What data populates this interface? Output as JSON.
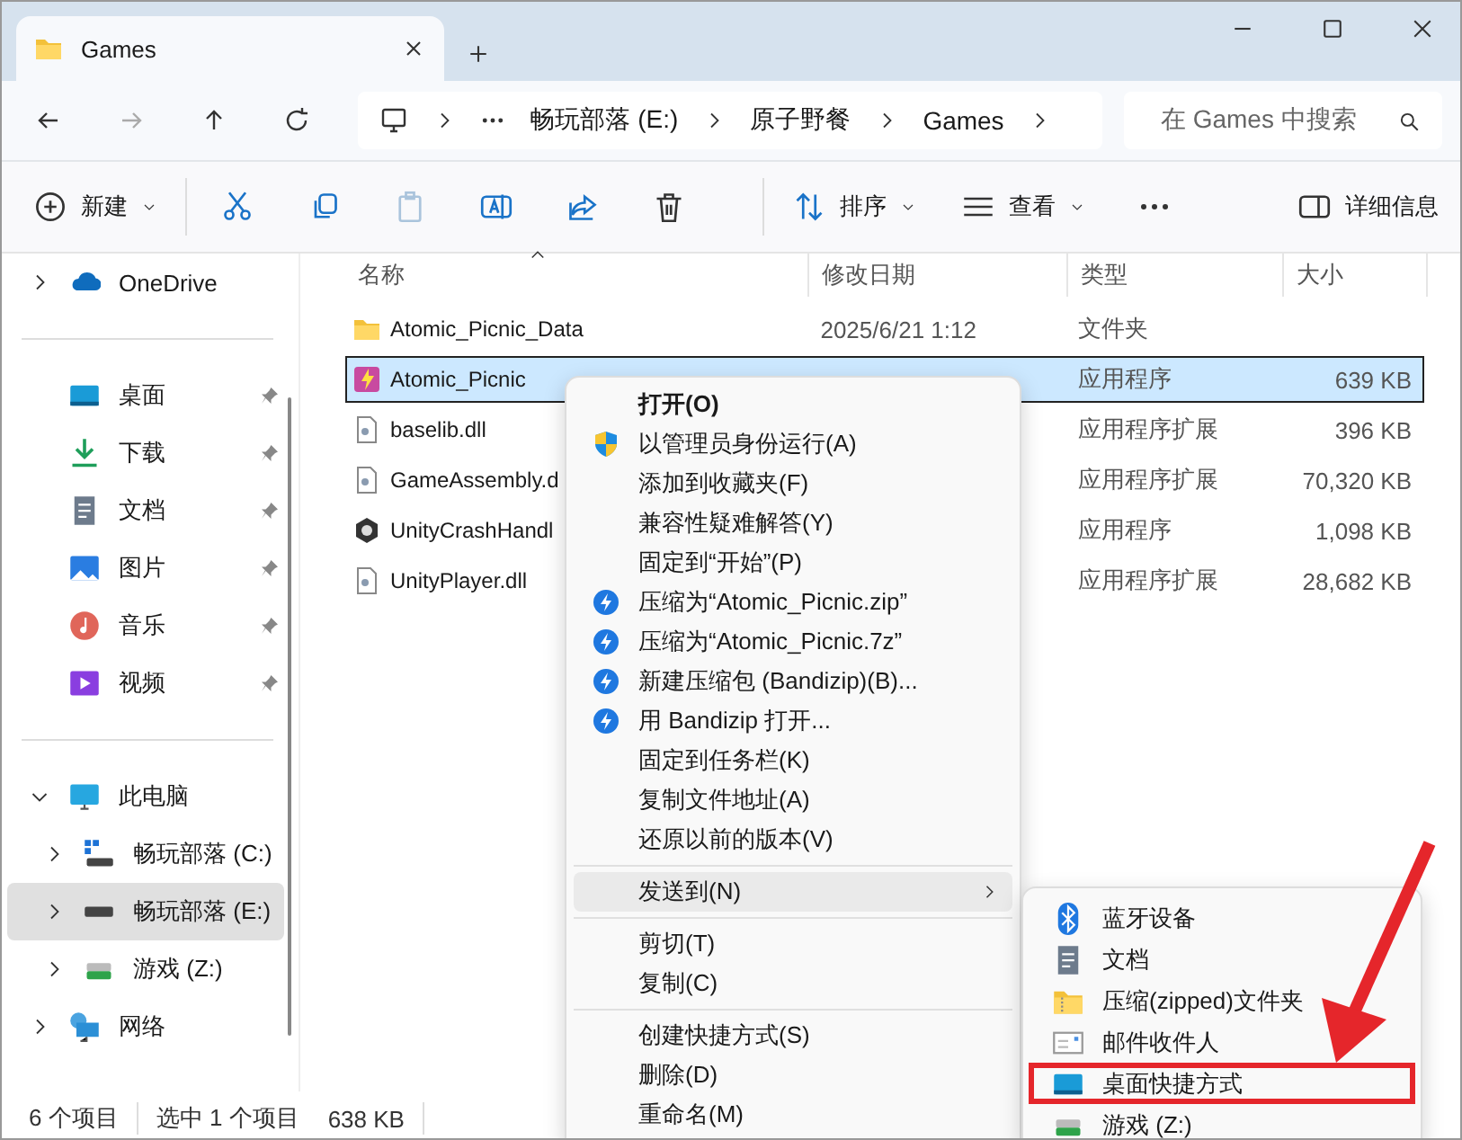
{
  "window": {
    "tab_title": "Games"
  },
  "address": {
    "crumbs": [
      "畅玩部落 (E:)",
      "原子野餐",
      "Games"
    ],
    "search_placeholder": "在 Games 中搜索"
  },
  "toolbar": {
    "new": "新建",
    "sort": "排序",
    "view": "查看",
    "details": "详细信息"
  },
  "sidebar": {
    "sections": [
      [
        {
          "label": "OneDrive",
          "kind": "cloud",
          "expanded": false,
          "selected": false
        }
      ],
      [
        {
          "label": "桌面",
          "kind": "desktop",
          "pinned": true,
          "selected": false
        },
        {
          "label": "下载",
          "kind": "download",
          "pinned": true,
          "selected": false
        },
        {
          "label": "文档",
          "kind": "document",
          "pinned": true,
          "selected": false
        },
        {
          "label": "图片",
          "kind": "picture",
          "pinned": true,
          "selected": false
        },
        {
          "label": "音乐",
          "kind": "music",
          "pinned": true,
          "selected": false
        },
        {
          "label": "视频",
          "kind": "video",
          "pinned": true,
          "selected": false
        }
      ],
      [
        {
          "label": "此电脑",
          "kind": "computer",
          "expanded": true,
          "selected": false,
          "children": [
            {
              "label": "畅玩部落 (C:)",
              "kind": "system-drive",
              "expanded": false,
              "selected": false
            },
            {
              "label": "畅玩部落 (E:)",
              "kind": "drive",
              "expanded": false,
              "selected": true
            },
            {
              "label": "游戏 (Z:)",
              "kind": "green-drive",
              "expanded": false,
              "selected": false
            }
          ]
        },
        {
          "label": "网络",
          "kind": "network",
          "expanded": false,
          "selected": false
        }
      ]
    ]
  },
  "table": {
    "columns": [
      "名称",
      "修改日期",
      "类型",
      "大小"
    ],
    "rows": [
      {
        "name": "Atomic_Picnic_Data",
        "kind": "folder",
        "date": "2025/6/21 1:12",
        "type": "文件夹",
        "selected": false
      },
      {
        "name": "Atomic_Picnic",
        "kind": "game",
        "type": "应用程序",
        "size": "639 KB",
        "selected": true
      },
      {
        "name": "baselib.dll",
        "kind": "dll",
        "type": "应用程序扩展",
        "size": "396 KB",
        "selected": false
      },
      {
        "name": "GameAssembly.d",
        "kind": "dll",
        "type": "应用程序扩展",
        "size": "70,320 KB",
        "selected": false
      },
      {
        "name": "UnityCrashHandl",
        "kind": "unity",
        "type": "应用程序",
        "size": "1,098 KB",
        "selected": false
      },
      {
        "name": "UnityPlayer.dll",
        "kind": "dll",
        "type": "应用程序扩展",
        "size": "28,682 KB",
        "selected": false
      }
    ]
  },
  "context_menu": {
    "groups": [
      [
        {
          "label": "打开(O)",
          "kind": "default",
          "highlighted": false
        },
        {
          "label": "以管理员身份运行(A)",
          "kind": "shield",
          "highlighted": false
        },
        {
          "label": "添加到收藏夹(F)",
          "kind": "plain",
          "highlighted": false
        },
        {
          "label": "兼容性疑难解答(Y)",
          "kind": "plain",
          "highlighted": false
        },
        {
          "label": "固定到“开始”(P)",
          "kind": "plain",
          "highlighted": false
        },
        {
          "label": "压缩为“Atomic_Picnic.zip”",
          "kind": "bandizip",
          "highlighted": false
        },
        {
          "label": "压缩为“Atomic_Picnic.7z”",
          "kind": "bandizip",
          "highlighted": false
        },
        {
          "label": "新建压缩包 (Bandizip)(B)...",
          "kind": "bandizip",
          "highlighted": false
        },
        {
          "label": "用 Bandizip 打开...",
          "kind": "bandizip",
          "highlighted": false
        },
        {
          "label": "固定到任务栏(K)",
          "kind": "plain",
          "highlighted": false
        },
        {
          "label": "复制文件地址(A)",
          "kind": "plain",
          "highlighted": false
        },
        {
          "label": "还原以前的版本(V)",
          "kind": "plain",
          "highlighted": false
        }
      ],
      [
        {
          "label": "发送到(N)",
          "kind": "submenu",
          "highlighted": true
        }
      ],
      [
        {
          "label": "剪切(T)",
          "kind": "plain",
          "highlighted": false
        },
        {
          "label": "复制(C)",
          "kind": "plain",
          "highlighted": false
        }
      ],
      [
        {
          "label": "创建快捷方式(S)",
          "kind": "plain",
          "highlighted": false
        },
        {
          "label": "删除(D)",
          "kind": "plain",
          "highlighted": false
        },
        {
          "label": "重命名(M)",
          "kind": "plain",
          "highlighted": false
        }
      ]
    ]
  },
  "send_to_menu": {
    "items": [
      {
        "label": "蓝牙设备",
        "kind": "bluetooth",
        "marked": false
      },
      {
        "label": "文档",
        "kind": "document",
        "marked": false
      },
      {
        "label": "压缩(zipped)文件夹",
        "kind": "zip-folder",
        "marked": false
      },
      {
        "label": "邮件收件人",
        "kind": "mail",
        "marked": false
      },
      {
        "label": "桌面快捷方式",
        "kind": "desktop",
        "marked": true
      },
      {
        "label": "游戏 (Z:)",
        "kind": "green-drive",
        "marked": false
      }
    ]
  },
  "status_bar": {
    "count": "6 个项目",
    "selection": "选中 1 个项目",
    "size": "638 KB"
  }
}
